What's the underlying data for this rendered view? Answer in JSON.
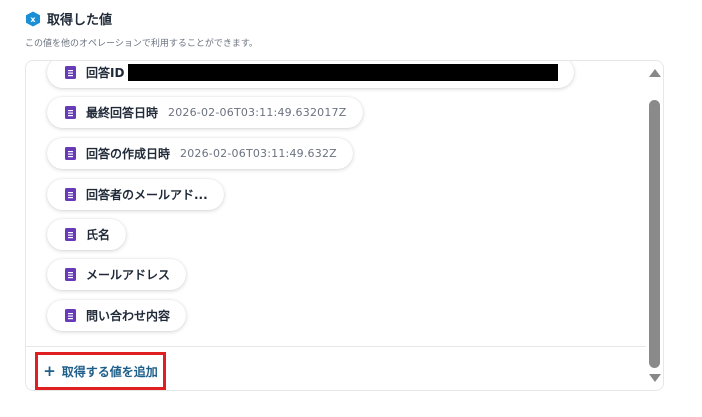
{
  "header": {
    "title": "取得した値",
    "subtitle": "この値を他のオペレーションで利用することができます。",
    "icon": "yoom-hexagon-icon"
  },
  "values": [
    {
      "label": "回答ID",
      "value": "",
      "redacted": true
    },
    {
      "label": "最終回答日時",
      "value": "2026-02-06T03:11:49.632017Z"
    },
    {
      "label": "回答の作成日時",
      "value": "2026-02-06T03:11:49.632Z"
    },
    {
      "label": "回答者のメールアド...",
      "value": ""
    },
    {
      "label": "氏名",
      "value": ""
    },
    {
      "label": "メールアドレス",
      "value": ""
    },
    {
      "label": "問い合わせ内容",
      "value": ""
    }
  ],
  "add_button": {
    "icon": "plus-icon",
    "plus": "+",
    "label": "取得する値を追加"
  },
  "colors": {
    "forms_icon": "#673ab7",
    "accent": "#1e5f8a",
    "highlight": "#e02020",
    "logo": "#1a8fd6"
  }
}
